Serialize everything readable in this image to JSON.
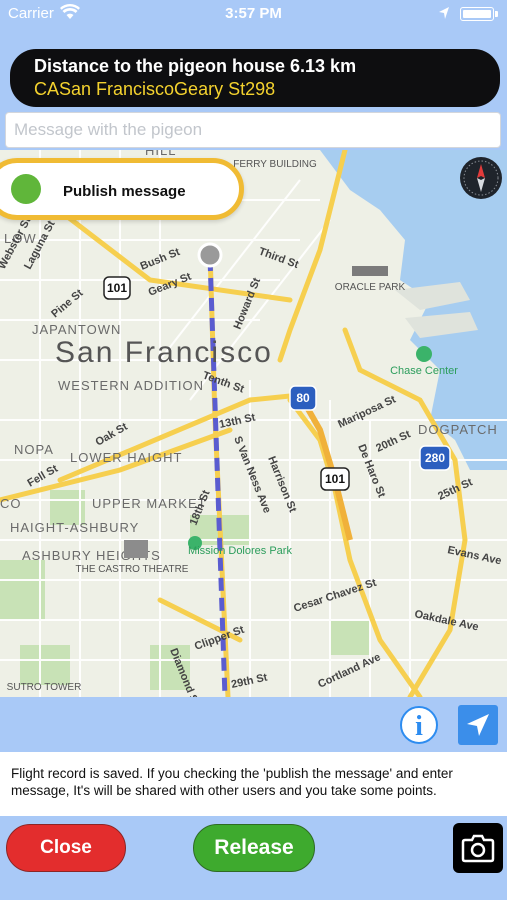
{
  "status_bar": {
    "carrier": "Carrier",
    "time": "3:57 PM",
    "icons": [
      "wifi-icon",
      "location-arrow-icon",
      "battery-icon"
    ]
  },
  "banner": {
    "distance_text": "Distance to the pigeon house  6.13 km",
    "address": "CASan FranciscoGeary St298"
  },
  "message": {
    "placeholder": "Message with the pigeon",
    "value": ""
  },
  "publish": {
    "label": "Publish message",
    "enabled": true
  },
  "map": {
    "city_label": "San Francisco",
    "neighborhoods": [
      "HILL",
      "LOW",
      "JAPANTOWN",
      "WESTERN ADDITION",
      "NOPA",
      "LOWER HAIGHT",
      "UPPER MARKET",
      "HAIGHT-ASHBURY",
      "ASHBURY HEIGHTS",
      "DOGPATCH",
      "CO"
    ],
    "streets": [
      "Webster St",
      "Laguna St",
      "Pine St",
      "Bush St",
      "Geary St",
      "Howard St",
      "Third St",
      "Tenth St",
      "13th St",
      "Oak St",
      "Fell St",
      "S Van Ness Ave",
      "Harrison St",
      "Mariposa St",
      "De Haro St",
      "20th St",
      "25th St",
      "18th St",
      "Evans Ave",
      "Cesar Chavez St",
      "Oakdale Ave",
      "Clipper St",
      "29th St",
      "Cortland Ave",
      "Diamond St"
    ],
    "pois": [
      "FERRY BUILDING",
      "ORACLE PARK",
      "Chase Center",
      "THE CASTRO THEATRE",
      "Mission Dolores Park",
      "SUTRO TOWER"
    ],
    "highway_shields": [
      "101",
      "80",
      "101",
      "280"
    ]
  },
  "controls": {
    "info_label": "i",
    "locate_icon": "navigation-arrow-icon"
  },
  "flight_record_text": "Flight record is saved. If you checking the 'publish the message' and enter message, It's will be shared with other users and you take some points.",
  "buttons": {
    "close": "Close",
    "release": "Release",
    "camera_icon": "camera-icon"
  },
  "colors": {
    "background": "#a9c9f7",
    "banner": "#0e0e10",
    "address": "#f4d22e",
    "toggle_border": "#f0bb34",
    "toggle_on": "#60b63a",
    "route": "#5a5cd0",
    "close": "#e32d2d",
    "release": "#3eaa2e",
    "info": "#2d8cf0"
  }
}
